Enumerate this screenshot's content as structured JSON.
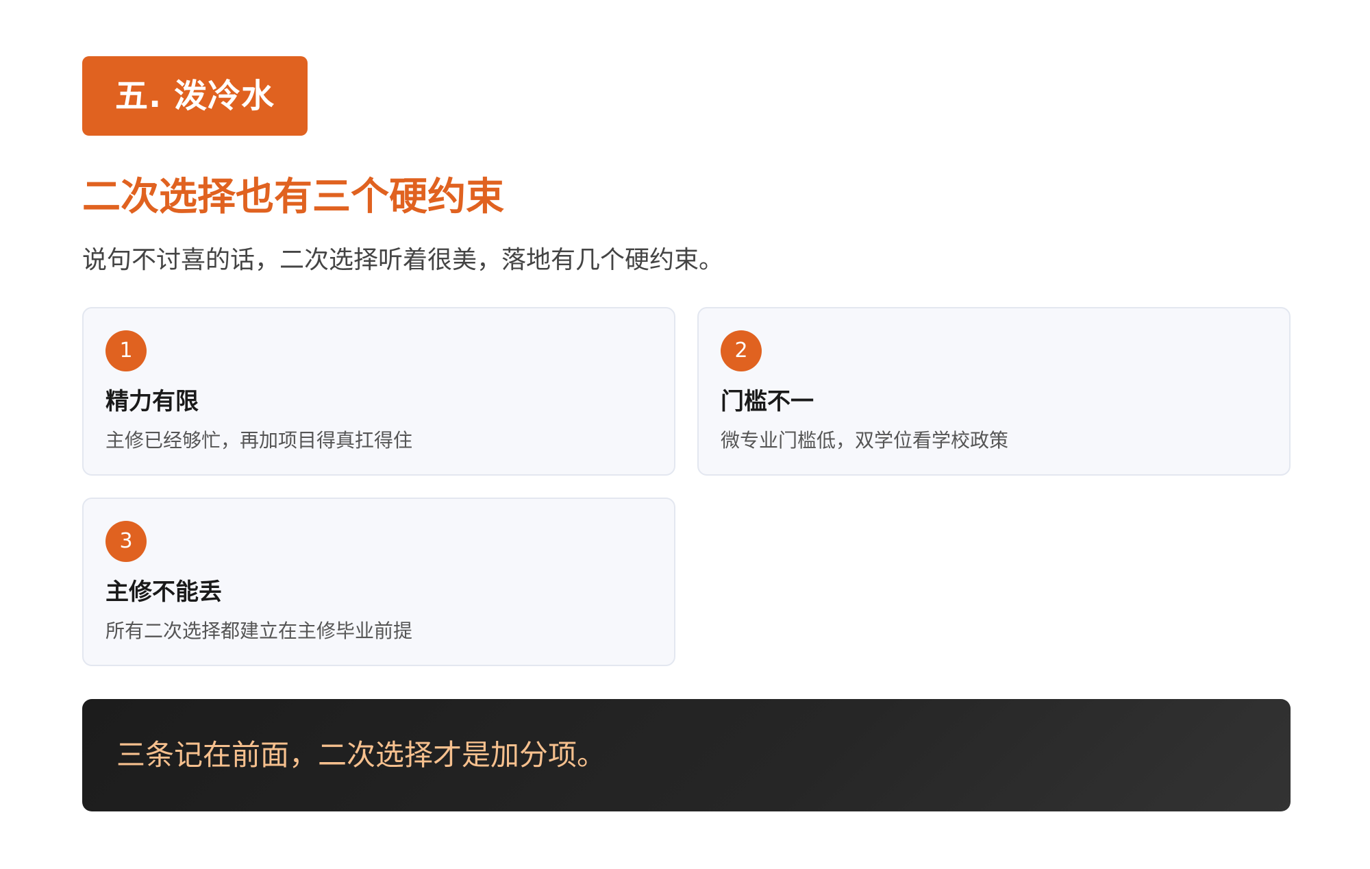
{
  "section": {
    "badge": "五. 泼冷水"
  },
  "headline": "二次选择也有三个硬约束",
  "subtitle": "说句不讨喜的话，二次选择听着很美，落地有几个硬约束。",
  "cards": [
    {
      "number": "1",
      "title": "精力有限",
      "desc": "主修已经够忙，再加项目得真扛得住"
    },
    {
      "number": "2",
      "title": "门槛不一",
      "desc": "微专业门槛低，双学位看学校政策"
    },
    {
      "number": "3",
      "title": "主修不能丢",
      "desc": "所有二次选择都建立在主修毕业前提"
    }
  ],
  "callout": {
    "text": "三条记在前面，二次选择才是加分项。"
  },
  "colors": {
    "accent": "#e06220",
    "card_bg": "#f7f8fc",
    "callout_bg": "#1c1c1c",
    "callout_text": "#f6c08e"
  }
}
